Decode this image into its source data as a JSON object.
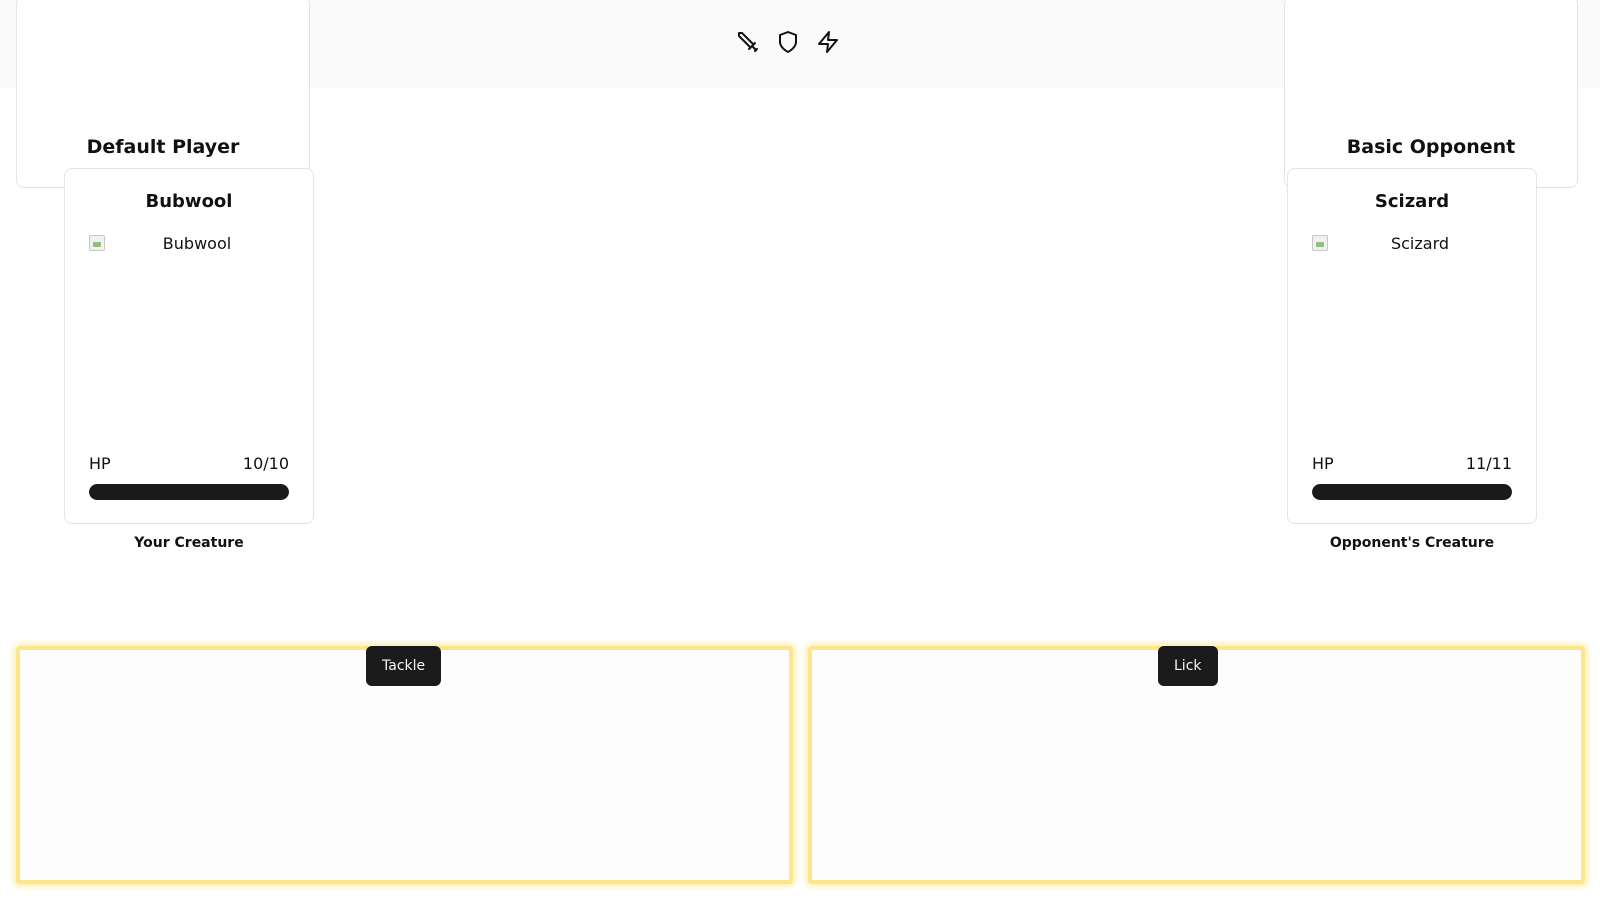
{
  "toolbar": {
    "icons": [
      "sword-icon",
      "shield-icon",
      "lightning-icon"
    ]
  },
  "player": {
    "name": "Default Player",
    "creature": {
      "name": "Bubwool",
      "image_alt": "Bubwool",
      "hp_label": "HP",
      "hp_text": "10/10",
      "hp_current": 10,
      "hp_max": 10
    },
    "caption": "Your Creature"
  },
  "opponent": {
    "name": "Basic Opponent",
    "creature": {
      "name": "Scizard",
      "image_alt": "Scizard",
      "hp_label": "HP",
      "hp_text": "11/11",
      "hp_current": 11,
      "hp_max": 11
    },
    "caption": "Opponent's Creature"
  },
  "moves": [
    {
      "label": "Tackle"
    },
    {
      "label": "Lick"
    }
  ],
  "colors": {
    "hp_bar": "#1a1a1a",
    "move_button": "#1b1b1b",
    "slot_highlight": "#fde58a"
  }
}
